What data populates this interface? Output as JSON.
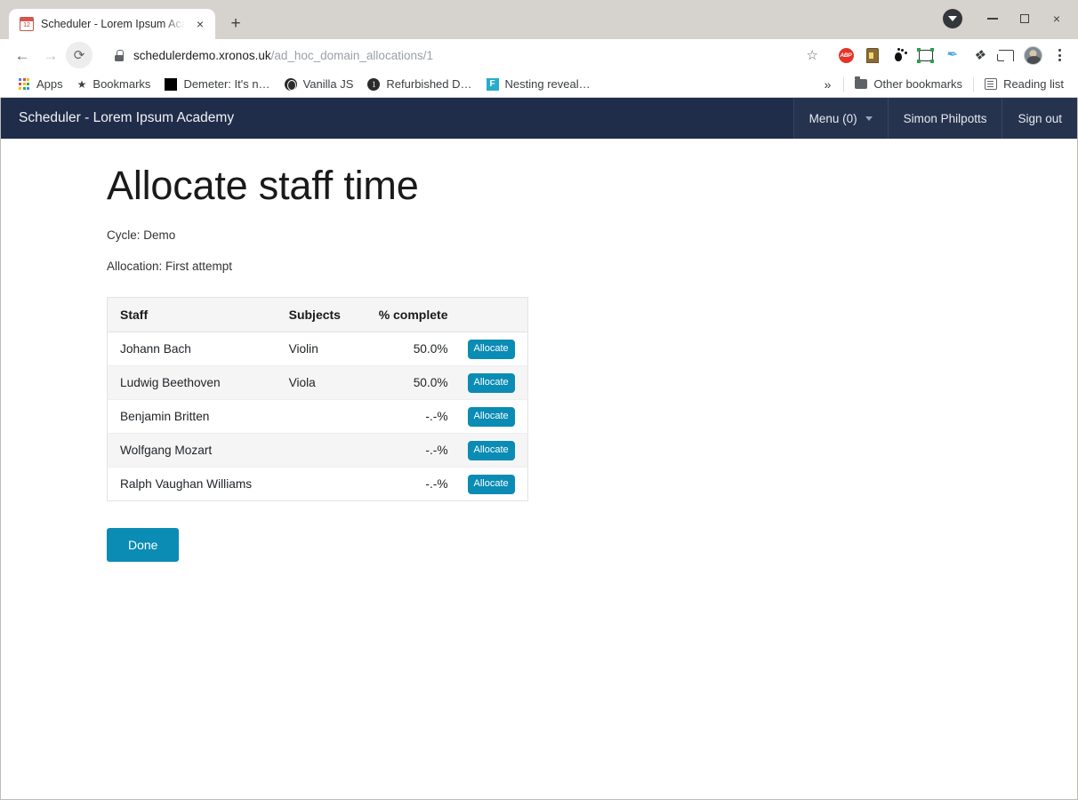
{
  "browser": {
    "tab": {
      "title": "Scheduler - Lorem Ipsum Academy",
      "favicon": "calendar-icon",
      "close_label": "×"
    },
    "new_tab_label": "+",
    "window_controls": {
      "download_indicator": "download-indicator",
      "minimize": "minimize",
      "maximize": "maximize",
      "close": "×"
    },
    "toolbar": {
      "back": "←",
      "forward": "→",
      "reload": "⟳",
      "url_domain": "schedulerdemo.xronos.uk",
      "url_path": "/ad_hoc_domain_allocations/1",
      "star": "☆",
      "extensions": [
        {
          "name": "adblock-plus-icon",
          "label": "ABP"
        },
        {
          "name": "door-icon",
          "label": ""
        },
        {
          "name": "gnome-foot-icon",
          "label": ""
        },
        {
          "name": "screenshot-crop-icon",
          "label": ""
        },
        {
          "name": "feather-icon",
          "label": "✒"
        },
        {
          "name": "puzzle-extensions-icon",
          "label": "❖"
        },
        {
          "name": "cast-icon",
          "label": ""
        }
      ],
      "profile_avatar": "user-avatar",
      "menu": "kebab-menu-icon"
    },
    "bookmarks": [
      {
        "label": "Apps",
        "icon": "apps-grid-icon"
      },
      {
        "label": "Bookmarks",
        "icon": "star-icon"
      },
      {
        "label": "Demeter: It's n…",
        "icon": "black-square-icon"
      },
      {
        "label": "Vanilla JS",
        "icon": "globe-icon"
      },
      {
        "label": "Refurbished D…",
        "icon": "circle-one-icon"
      },
      {
        "label": "Nesting reveal…",
        "icon": "figma-icon"
      }
    ],
    "bookmarks_overflow": "»",
    "other_bookmarks": {
      "label": "Other bookmarks",
      "icon": "folder-icon"
    },
    "reading_list": {
      "label": "Reading list",
      "icon": "reading-list-icon"
    }
  },
  "app": {
    "brand": "Scheduler - Lorem Ipsum Academy",
    "nav": {
      "menu": "Menu (0)",
      "user": "Simon Philpotts",
      "signout": "Sign out"
    },
    "page_title": "Allocate staff time",
    "cycle": "Cycle: Demo",
    "allocation": "Allocation: First attempt",
    "table": {
      "headers": [
        "Staff",
        "Subjects",
        "% complete",
        ""
      ],
      "rows": [
        {
          "staff": "Johann Bach",
          "subjects": "Violin",
          "percent": "50.0%",
          "action": "Allocate"
        },
        {
          "staff": "Ludwig Beethoven",
          "subjects": "Viola",
          "percent": "50.0%",
          "action": "Allocate"
        },
        {
          "staff": "Benjamin Britten",
          "subjects": "",
          "percent": "-.-%",
          "action": "Allocate"
        },
        {
          "staff": "Wolfgang Mozart",
          "subjects": "",
          "percent": "-.-%",
          "action": "Allocate"
        },
        {
          "staff": "Ralph Vaughan Williams",
          "subjects": "",
          "percent": "-.-%",
          "action": "Allocate"
        }
      ]
    },
    "done_button": "Done",
    "colors": {
      "navbar": "#1f2d4a",
      "navbar_right": "#25334f",
      "accent": "#0a8cb4",
      "stripe": "#f5f5f5"
    }
  }
}
